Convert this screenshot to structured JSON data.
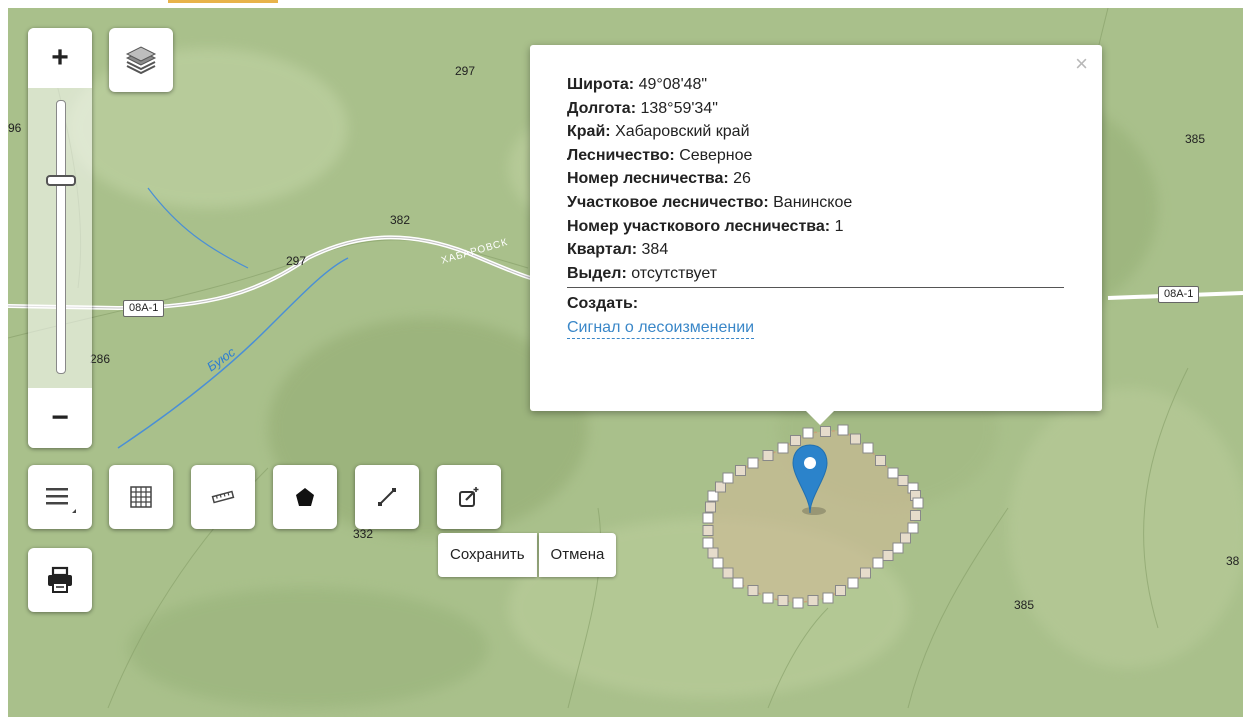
{
  "controls": {
    "zoom_in": "+",
    "zoom_out": "−",
    "layers_icon": "layers-icon",
    "tools": [
      "menu-icon",
      "grid-icon",
      "ruler-icon",
      "polygon-icon",
      "line-icon",
      "edit-icon",
      "print-icon"
    ]
  },
  "map_labels": {
    "elev_297_top": "297",
    "elev_96": "96",
    "elev_385_right": "385",
    "elev_382": "382",
    "elev_297_mid": "297",
    "elev_286": "286",
    "elev_385_bottom": "385",
    "elev_38": "38",
    "elev_332": "332",
    "road_left": "08A-1",
    "road_right": "08A-1",
    "road_name": "ХАБАРОВСК",
    "river": "Буюс"
  },
  "popup": {
    "close": "×",
    "rows": [
      {
        "label": "Широта:",
        "value": "49°08'48\""
      },
      {
        "label": "Долгота:",
        "value": "138°59'34\""
      },
      {
        "label": "Край:",
        "value": "Хабаровский край"
      },
      {
        "label": "Лесничество:",
        "value": "Северное"
      },
      {
        "label": "Номер лесничества:",
        "value": "26"
      },
      {
        "label": "Участковое лесничество:",
        "value": "Ванинское"
      },
      {
        "label": "Номер участкового лесничества:",
        "value": "1"
      },
      {
        "label": "Квартал:",
        "value": "384"
      },
      {
        "label": "Выдел:",
        "value": "отсутствует"
      }
    ],
    "create_label": "Создать:",
    "link": "Сигнал о лесоизменении"
  },
  "editbar": {
    "save": "Сохранить",
    "cancel": "Отмена"
  },
  "colors": {
    "map_base": "#a9c08b",
    "accent": "#e8b34a",
    "link": "#3a87c8",
    "marker": "#2b83cb"
  }
}
